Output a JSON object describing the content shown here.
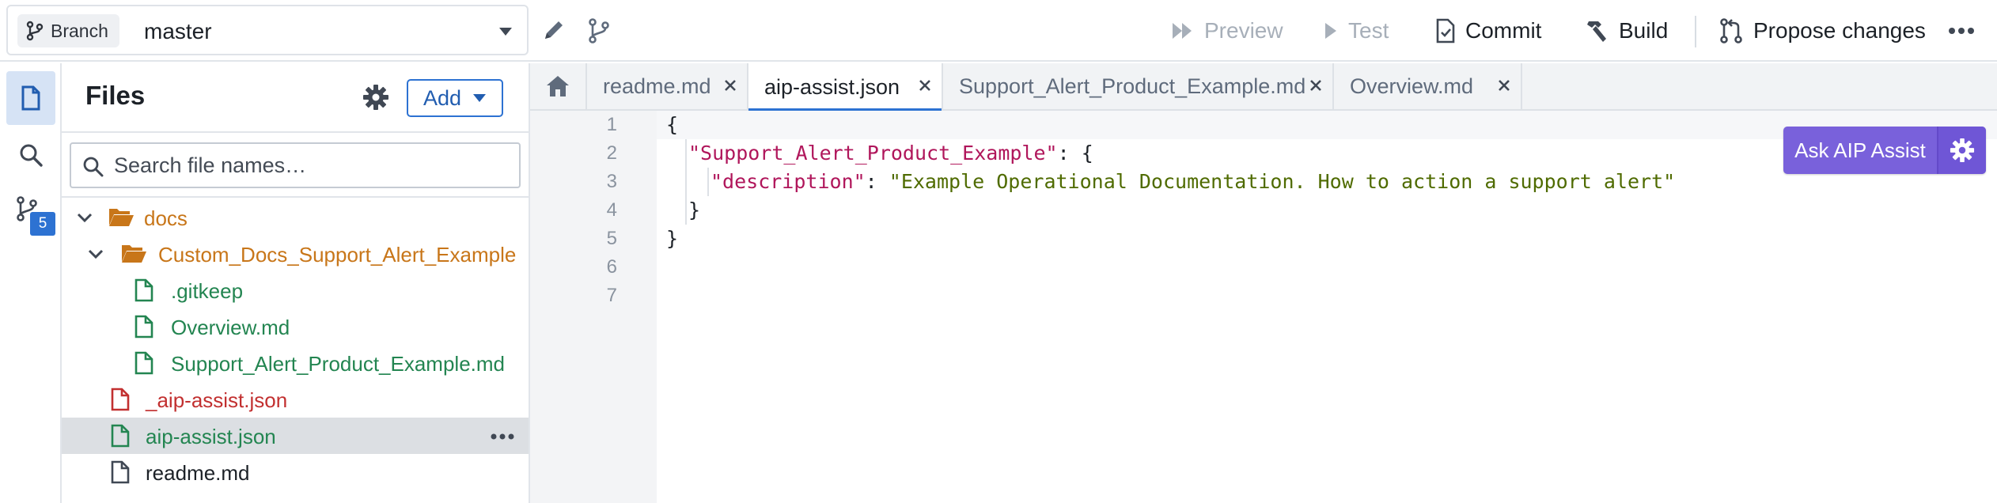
{
  "toolbar": {
    "branch_label": "Branch",
    "branch_name": "master",
    "preview_label": "Preview",
    "test_label": "Test",
    "commit_label": "Commit",
    "build_label": "Build",
    "propose_label": "Propose changes"
  },
  "rail": {
    "badge_count": "5"
  },
  "files": {
    "title": "Files",
    "add_label": "Add",
    "search_placeholder": "Search file names…",
    "tree": [
      {
        "label": "docs",
        "type": "folder"
      },
      {
        "label": "Custom_Docs_Support_Alert_Example",
        "type": "folder"
      },
      {
        "label": ".gitkeep",
        "type": "file-added"
      },
      {
        "label": "Overview.md",
        "type": "file-added"
      },
      {
        "label": "Support_Alert_Product_Example.md",
        "type": "file-added"
      },
      {
        "label": "_aip-assist.json",
        "type": "file-deleted"
      },
      {
        "label": "aip-assist.json",
        "type": "file-added",
        "selected": true
      },
      {
        "label": "readme.md",
        "type": "file"
      }
    ]
  },
  "tabs": [
    {
      "label": "readme.md"
    },
    {
      "label": "aip-assist.json",
      "active": true
    },
    {
      "label": "Support_Alert_Product_Example.md"
    },
    {
      "label": "Overview.md"
    }
  ],
  "editor": {
    "line_numbers": [
      "1",
      "2",
      "3",
      "4",
      "5",
      "6",
      "7"
    ],
    "code": {
      "l1": "{",
      "l2_key": "\"Support_Alert_Product_Example\"",
      "l2_rest": ": {",
      "l3_key": "\"description\"",
      "l3_colon": ": ",
      "l3_value": "\"Example Operational Documentation. How to action a support alert\"",
      "l4": "}",
      "l5": "}"
    }
  },
  "aip_assist": {
    "label": "Ask AIP Assist"
  },
  "colors": {
    "accent": "#2d72d2",
    "folder": "#c87619",
    "added": "#238551",
    "deleted": "#c23030",
    "aip": "#7961db"
  }
}
